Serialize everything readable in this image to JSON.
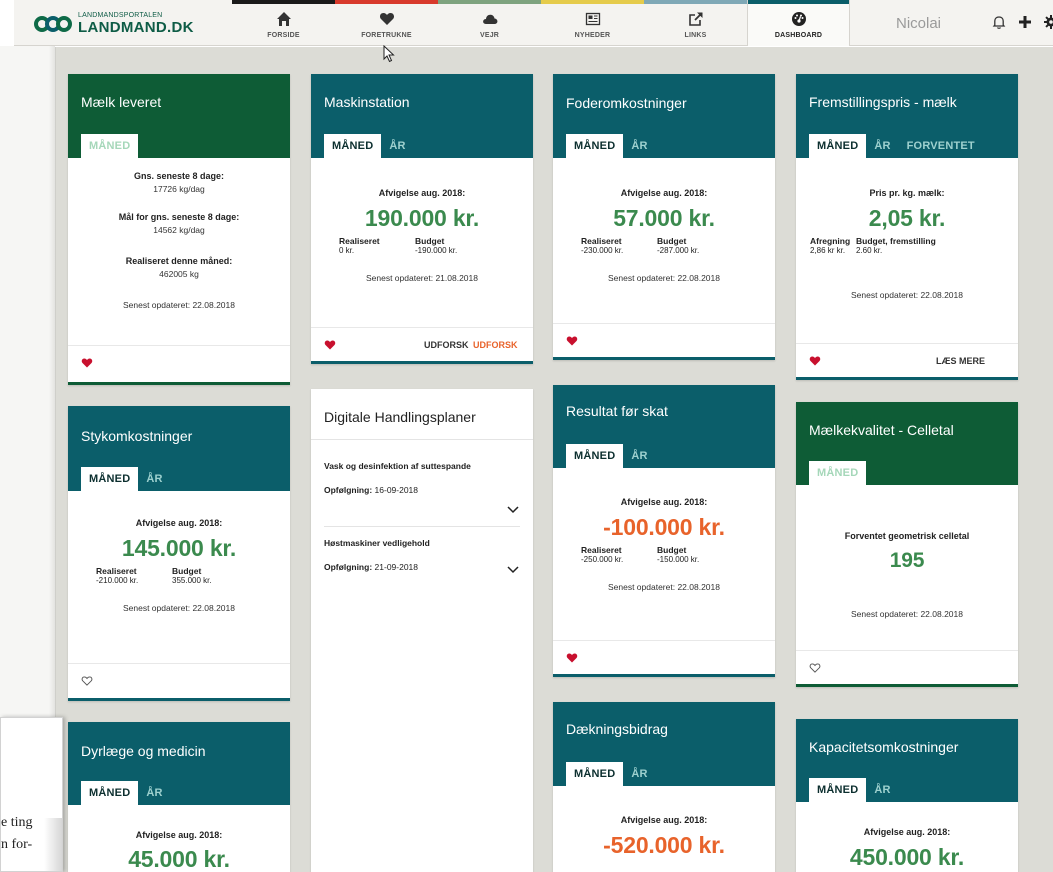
{
  "app": {
    "logo_small": "LANDMANDSPORTALEN",
    "logo_big": "LANDMAND.DK"
  },
  "nav": [
    {
      "label": "FORSIDE",
      "icon": "home-icon",
      "color": "#1a1a1a"
    },
    {
      "label": "FORETRUKNE",
      "icon": "heart-icon",
      "color": "#d83a2c"
    },
    {
      "label": "VEJR",
      "icon": "cloud-icon",
      "color": "#7ea37f"
    },
    {
      "label": "NYHEDER",
      "icon": "newspaper-icon",
      "color": "#e5cb4b"
    },
    {
      "label": "LINKS",
      "icon": "external-link-icon",
      "color": "#7fa8b6"
    },
    {
      "label": "DASHBOARD",
      "icon": "dashboard-icon",
      "color": "#0b5e6a",
      "active": true
    }
  ],
  "user": {
    "name": "Nicolai"
  },
  "colors": {
    "teal": "#0b5e6a",
    "green": "#0e5c36",
    "value_green": "#3b8a4e",
    "value_red": "#e8632b",
    "heart": "#c8102e"
  },
  "cards": {
    "maelk": {
      "title": "Mælk leveret",
      "tabs": [
        "MÅNED"
      ],
      "l1": "Gns. seneste 8 dage:",
      "v1": "17726 kg/dag",
      "l2": "Mål for gns. seneste 8 dage:",
      "v2": "14562 kg/dag",
      "l3": "Realiseret denne måned:",
      "v3": "462005 kg",
      "updated": "Senest opdateret: 22.08.2018",
      "favorite": true
    },
    "maskin": {
      "title": "Maskinstation",
      "tabs": [
        "MÅNED",
        "ÅR"
      ],
      "dev_label": "Afvigelse aug. 2018:",
      "value": "190.000 kr.",
      "real_label": "Realiseret",
      "real_value": "0 kr.",
      "budget_label": "Budget",
      "budget_value": "-190.000 kr.",
      "updated": "Senest opdateret: 21.08.2018",
      "link1": "UDFORSK",
      "link2": "UDFORSK",
      "favorite": true
    },
    "foder": {
      "title": "Foderomkostninger",
      "tabs": [
        "MÅNED",
        "ÅR"
      ],
      "dev_label": "Afvigelse aug. 2018:",
      "value": "57.000 kr.",
      "real_label": "Realiseret",
      "real_value": "-230.000 kr.",
      "budget_label": "Budget",
      "budget_value": "-287.000 kr.",
      "updated": "Senest opdateret: 22.08.2018",
      "favorite": true
    },
    "fremst": {
      "title": "Fremstillingspris - mælk",
      "tabs": [
        "MÅNED",
        "ÅR",
        "FORVENTET"
      ],
      "dev_label": "Pris pr. kg. mælk:",
      "value": "2,05 kr.",
      "real_label": "Afregning",
      "real_value": "2,86 kr kr.",
      "budget_label": "Budget, fremstilling",
      "budget_value": "2.60 kr.",
      "updated": "Senest opdateret: 22.08.2018",
      "link1": "LÆS MERE",
      "favorite": true
    },
    "styk": {
      "title": "Stykomkostninger",
      "tabs": [
        "MÅNED",
        "ÅR"
      ],
      "dev_label": "Afvigelse aug. 2018:",
      "value": "145.000 kr.",
      "real_label": "Realiseret",
      "real_value": "-210.000 kr.",
      "budget_label": "Budget",
      "budget_value": "355.000 kr.",
      "updated": "Senest opdateret: 22.08.2018",
      "favorite": false
    },
    "dhp": {
      "title": "Digitale Handlingsplaner",
      "items": [
        {
          "title": "Vask og desinfektion af suttespande",
          "follow_label": "Opfølgning:",
          "follow_date": "16-09-2018"
        },
        {
          "title": "Høstmaskiner vedligehold",
          "follow_label": "Opfølgning:",
          "follow_date": "21-09-2018"
        }
      ]
    },
    "resultat": {
      "title": "Resultat før skat",
      "tabs": [
        "MÅNED",
        "ÅR"
      ],
      "dev_label": "Afvigelse aug. 2018:",
      "value": "-100.000 kr.",
      "real_label": "Realiseret",
      "real_value": "-250.000 kr.",
      "budget_label": "Budget",
      "budget_value": "-150.000 kr.",
      "updated": "Senest opdateret: 22.08.2018",
      "favorite": true
    },
    "celletal": {
      "title": "Mælkekvalitet - Celletal",
      "tabs": [
        "MÅNED"
      ],
      "label": "Forventet geometrisk celletal",
      "value": "195",
      "updated": "Senest opdateret: 22.08.2018",
      "favorite": false
    },
    "dyr": {
      "title": "Dyrlæge og medicin",
      "tabs": [
        "MÅNED",
        "ÅR"
      ],
      "dev_label": "Afvigelse aug. 2018:",
      "value": "45.000 kr."
    },
    "daek": {
      "title": "Dækningsbidrag",
      "tabs": [
        "MÅNED",
        "ÅR"
      ],
      "dev_label": "Afvigelse aug. 2018:",
      "value": "-520.000 kr."
    },
    "kapacitet": {
      "title": "Kapacitetsomkostninger",
      "tabs": [
        "MÅNED",
        "ÅR"
      ],
      "dev_label": "Afvigelse aug. 2018:",
      "value": "450.000 kr."
    }
  },
  "overlay_text": {
    "line1": "e ting",
    "line2": "n for-"
  }
}
